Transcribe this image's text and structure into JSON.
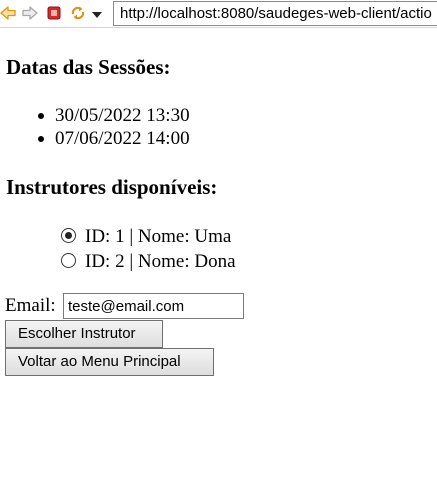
{
  "browser": {
    "url": "http://localhost:8080/saudeges-web-client/actio",
    "icons": [
      "back-arrow-icon",
      "forward-arrow-icon",
      "stop-icon",
      "refresh-icon",
      "dropdown-menu-icon"
    ],
    "colors": {
      "back_arrow": "#f0a020",
      "stop": "#d0202a",
      "refresh": "#e09020"
    }
  },
  "sessions": {
    "title": "Datas das Sessões:",
    "items": [
      "30/05/2022 13:30",
      "07/06/2022 14:00"
    ]
  },
  "instructors": {
    "title": "Instrutores disponíveis:",
    "options": [
      {
        "label": "ID: 1 | Nome: Uma",
        "checked": true
      },
      {
        "label": "ID: 2 | Nome: Dona",
        "checked": false
      }
    ]
  },
  "form": {
    "email_label": "Email:",
    "email_value": "teste@email.com",
    "choose_button": "Escolher Instrutor",
    "back_button": "Voltar ao Menu Principal"
  }
}
